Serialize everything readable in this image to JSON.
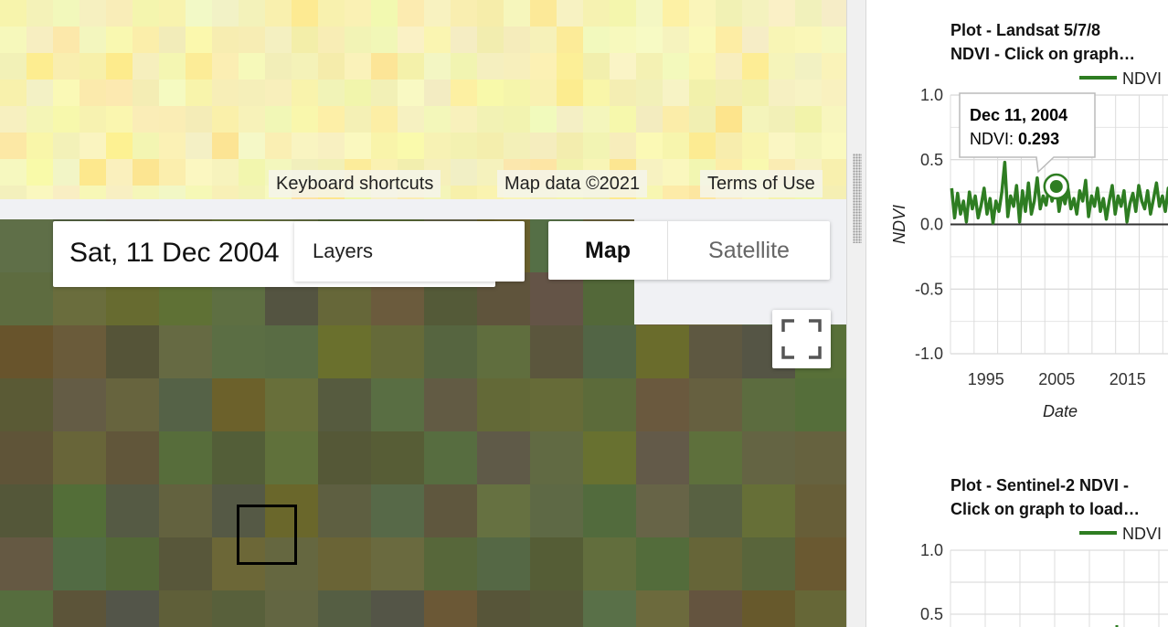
{
  "map": {
    "attribution": {
      "keyboard_shortcuts": "Keyboard shortcuts",
      "map_data": "Map data ©2021",
      "terms": "Terms of Use"
    },
    "date_label": "Sat, 11 Dec 2004",
    "layers_label": "Layers",
    "map_type": {
      "map_label": "Map",
      "satellite_label": "Satellite",
      "selected": "Map"
    },
    "fullscreen_icon": "fullscreen-icon",
    "colors": {
      "upper_layer": "#f7f3b8",
      "lower_layer": "#5f613f",
      "selection": "#000000"
    }
  },
  "charts": {
    "line_color": "#2e7d22",
    "landsat": {
      "title_line1": "Plot - Landsat 5/7/8",
      "title_line2": "NDVI - Click on graph…",
      "tooltip": {
        "date": "Dec 11, 2004",
        "label": "NDVI:",
        "value": "0.293"
      }
    },
    "sentinel": {
      "title_line1": "Plot - Sentinel-2 NDVI -",
      "title_line2": "Click on graph to load…"
    }
  },
  "chart_data": [
    {
      "type": "line",
      "title": "Plot - Landsat 5/7/8 NDVI - Click on graph…",
      "xlabel": "Date",
      "ylabel": "NDVI",
      "legend": [
        "NDVI"
      ],
      "legend_position": "top-right",
      "grid": true,
      "ylim": [
        -1.0,
        1.0
      ],
      "yticks": [
        "1.0",
        "0.5",
        "0.0",
        "-0.5",
        "-1.0"
      ],
      "xticks": [
        "1995",
        "2005",
        "2015"
      ],
      "xlim": [
        "1990-01-01",
        "2021-12-31"
      ],
      "series": [
        {
          "name": "NDVI",
          "x": [
            "1990-03-01",
            "1990-08-01",
            "1991-01-01",
            "1991-06-01",
            "1991-11-01",
            "1992-04-01",
            "1992-09-01",
            "1993-02-01",
            "1993-07-01",
            "1993-12-01",
            "1994-05-01",
            "1994-10-01",
            "1995-03-01",
            "1995-08-01",
            "1996-01-01",
            "1996-06-01",
            "1996-11-01",
            "1997-04-01",
            "1997-09-01",
            "1998-02-01",
            "1998-07-01",
            "1998-12-01",
            "1999-05-01",
            "1999-10-01",
            "2000-03-01",
            "2000-08-01",
            "2001-01-01",
            "2001-06-01",
            "2001-11-01",
            "2002-04-01",
            "2002-09-01",
            "2003-02-01",
            "2003-07-01",
            "2003-12-01",
            "2004-05-01",
            "2004-12-11",
            "2005-05-01",
            "2005-10-01",
            "2006-03-01",
            "2006-08-01",
            "2007-01-01",
            "2007-06-01",
            "2007-11-01",
            "2008-04-01",
            "2008-09-01",
            "2009-02-01",
            "2009-07-01",
            "2009-12-01",
            "2010-05-01",
            "2010-10-01",
            "2011-03-01",
            "2011-08-01",
            "2012-01-01",
            "2012-06-01",
            "2012-11-01",
            "2013-04-01",
            "2013-09-01",
            "2014-02-01",
            "2014-07-01",
            "2014-12-01",
            "2015-05-01",
            "2015-10-01",
            "2016-03-01",
            "2016-08-01",
            "2017-01-01",
            "2017-06-01",
            "2017-11-01",
            "2018-04-01",
            "2018-09-01",
            "2019-02-01",
            "2019-07-01",
            "2019-12-01",
            "2020-05-01",
            "2020-10-01",
            "2021-03-01",
            "2021-08-01"
          ],
          "values": [
            0.28,
            0.05,
            0.24,
            0.08,
            0.18,
            0.02,
            0.25,
            0.12,
            0.22,
            0.05,
            0.15,
            0.28,
            0.08,
            0.2,
            0.01,
            0.18,
            0.1,
            0.25,
            0.48,
            0.06,
            0.22,
            0.14,
            0.3,
            0.02,
            0.26,
            0.1,
            0.32,
            0.08,
            0.18,
            0.36,
            0.12,
            0.22,
            0.15,
            0.3,
            0.18,
            0.293,
            0.1,
            0.24,
            0.16,
            0.28,
            0.12,
            0.2,
            0.08,
            0.26,
            0.18,
            0.34,
            0.06,
            0.22,
            0.14,
            0.28,
            0.1,
            0.2,
            0.04,
            0.18,
            0.3,
            0.08,
            0.22,
            0.14,
            0.26,
            0.02,
            0.16,
            0.24,
            0.1,
            0.3,
            0.18,
            0.12,
            0.26,
            0.08,
            0.2,
            0.32,
            0.14,
            0.22,
            0.1,
            0.28,
            0.18,
            0.3
          ]
        }
      ],
      "highlight": {
        "x": "2004-12-11",
        "y": 0.293
      }
    },
    {
      "type": "line",
      "title": "Plot - Sentinel-2 NDVI - Click on graph to load…",
      "legend": [
        "NDVI"
      ],
      "legend_position": "top-right",
      "grid": true,
      "ylim": [
        -1.0,
        1.0
      ],
      "yticks": [
        "1.0",
        "0.5"
      ],
      "series": [
        {
          "name": "NDVI",
          "x": [],
          "values": []
        }
      ]
    }
  ]
}
